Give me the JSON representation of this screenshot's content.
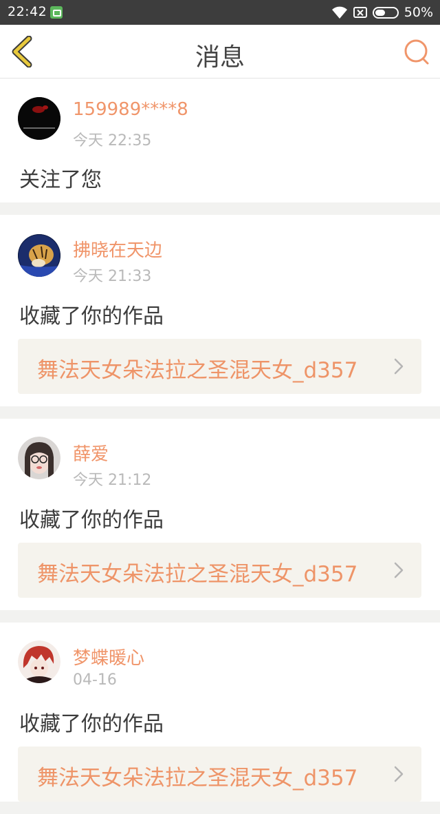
{
  "status_bar": {
    "time": "22:42",
    "battery_percent": "50%",
    "battery_level": 0.5,
    "icons": [
      "app-notification-icon",
      "wifi-icon",
      "no-sim-icon",
      "battery-icon"
    ]
  },
  "header": {
    "title": "消息",
    "back_icon": "chevron-left-icon",
    "search_icon": "search-icon"
  },
  "colors": {
    "accent": "#f0956a",
    "back_icon": "#e8c93c",
    "text": "#3c3c3c",
    "muted": "#b9b9b9",
    "work_bg": "#f5f3ed"
  },
  "messages": [
    {
      "username": "159989****8",
      "time": "今天 22:35",
      "action": "关注了您"
    },
    {
      "username": "拂晓在天边",
      "time": "今天 21:33",
      "action": "收藏了你的作品",
      "work_title": "舞法天女朵法拉之圣混天女_d357"
    },
    {
      "username": "薛爱",
      "time": "今天 21:12",
      "action": "收藏了你的作品",
      "work_title": "舞法天女朵法拉之圣混天女_d357"
    },
    {
      "username": "梦蝶暖心",
      "time": "04-16",
      "action": "收藏了你的作品",
      "work_title": "舞法天女朵法拉之圣混天女_d357"
    }
  ]
}
